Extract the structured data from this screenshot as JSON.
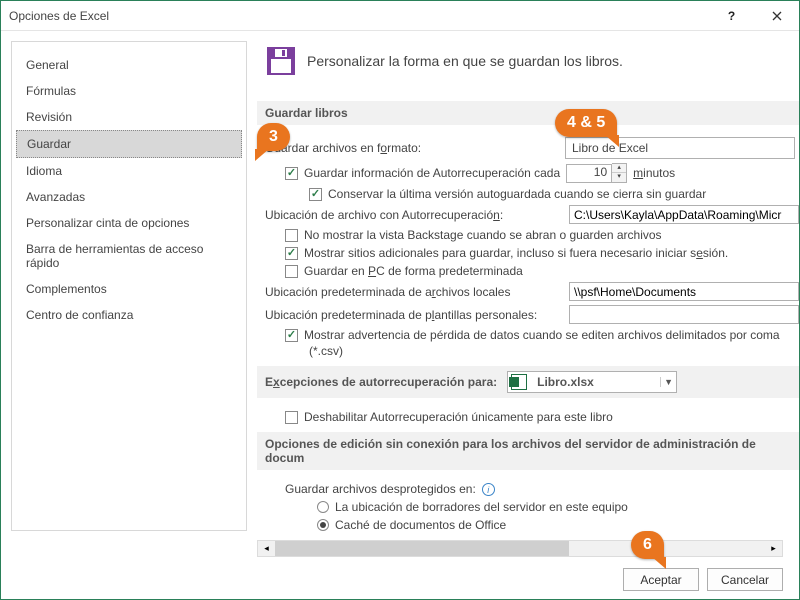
{
  "window": {
    "title": "Opciones de Excel"
  },
  "sidebar": {
    "items": [
      {
        "label": "General"
      },
      {
        "label": "Fórmulas"
      },
      {
        "label": "Revisión"
      },
      {
        "label": "Guardar",
        "selected": true
      },
      {
        "label": "Idioma"
      },
      {
        "label": "Avanzadas"
      },
      {
        "label": "Personalizar cinta de opciones"
      },
      {
        "label": "Barra de herramientas de acceso rápido"
      },
      {
        "label": "Complementos"
      },
      {
        "label": "Centro de confianza"
      }
    ]
  },
  "heading": "Personalizar la forma en que se guardan los libros.",
  "section1": {
    "title": "Guardar libros",
    "save_format_label_pre": "Guardar archivos en f",
    "save_format_label_hot": "o",
    "save_format_label_post": "rmato:",
    "save_format_value": "Libro de Excel",
    "autorecover_cb": "Guardar información de Autorrecuperación cada",
    "autorecover_value": "10",
    "autorecover_unit_hot": "m",
    "autorecover_unit_post": "inutos",
    "keep_last_cb": "Conservar la última versión autoguardada cuando se cierra sin guardar",
    "autorecover_loc_label_pre": "Ubicación de archivo con Autorrecuperació",
    "autorecover_loc_label_hot": "n",
    "autorecover_loc_label_post": ":",
    "autorecover_loc_value": "C:\\Users\\Kayla\\AppData\\Roaming\\Micr",
    "no_backstage_cb": "No mostrar la vista Backstage cuando se abran o guarden archivos",
    "show_places_pre": "Mostrar sitios adicionales para guardar, incluso si fuera necesario iniciar s",
    "show_places_hot": "e",
    "show_places_post": "sión.",
    "save_pc_pre": "Guardar en ",
    "save_pc_hot": "P",
    "save_pc_post": "C de forma predeterminada",
    "default_local_pre": "Ubicación predeterminada de a",
    "default_local_hot": "r",
    "default_local_post": "chivos locales",
    "default_local_value": "\\\\psf\\Home\\Documents",
    "default_tmpl_pre": "Ubicación predeterminada de p",
    "default_tmpl_hot": "l",
    "default_tmpl_post": "antillas personales:",
    "csv_warn_cb": "Mostrar advertencia de pérdida de datos cuando se editen archivos delimitados por coma",
    "csv_warn_sub": "(*.csv)"
  },
  "section2": {
    "title_pre": "E",
    "title_hot": "x",
    "title_post": "cepciones de autorrecuperación para:",
    "book_name": "Libro.xlsx",
    "disable_cb": "Deshabilitar Autorrecuperación únicamente para este libro"
  },
  "section3": {
    "title": "Opciones de edición sin conexión para los archivos del servidor de administración de docum",
    "save_checked_label": "Guardar archivos desprotegidos en:",
    "opt1": "La ubicación de borradores del servidor en este equipo",
    "opt2": "Caché de documentos de Office"
  },
  "footer": {
    "ok": "Aceptar",
    "cancel": "Cancelar"
  },
  "callouts": {
    "c3": "3",
    "c45": "4 & 5",
    "c6": "6"
  }
}
